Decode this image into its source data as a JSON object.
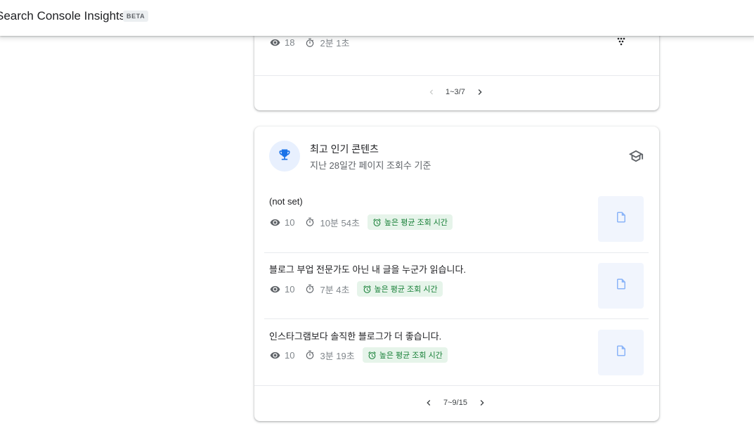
{
  "header": {
    "app_title": "Search Console Insights",
    "beta_badge": "BETA"
  },
  "colors": {
    "accent_blue": "#1a73e8",
    "chip_green_bg": "#e6f4ea",
    "chip_green_text": "#188038",
    "thumb_bg": "#f1f5fd"
  },
  "card_top": {
    "stats": {
      "views": "18",
      "duration": "2분 1초"
    },
    "pager": {
      "range": "1~3/7"
    }
  },
  "card_popular": {
    "title": "최고 인기 콘텐츠",
    "subtitle": "지난 28일간 페이지 조회수 기준",
    "items": [
      {
        "title": "(not set)",
        "views": "10",
        "duration": "10분 54초",
        "chip": "높은 평균 조회 시간"
      },
      {
        "title": "블로그 부업 전문가도 아닌 내 글을 누군가 읽습니다.",
        "views": "10",
        "duration": "7분 4초",
        "chip": "높은 평균 조회 시간"
      },
      {
        "title": "인스타그램보다 솔직한 블로그가 더 좋습니다.",
        "views": "10",
        "duration": "3분 19초",
        "chip": "높은 평균 조회 시간"
      }
    ],
    "pager": {
      "range": "7~9/15"
    }
  },
  "icons": {
    "views": "eye-icon",
    "duration": "timer-icon",
    "chip": "alarm-icon",
    "trophy": "trophy-icon",
    "learn": "school-icon",
    "thumb": "document-icon",
    "more": "dots-icon",
    "prev": "chevron-left-icon",
    "next": "chevron-right-icon"
  }
}
